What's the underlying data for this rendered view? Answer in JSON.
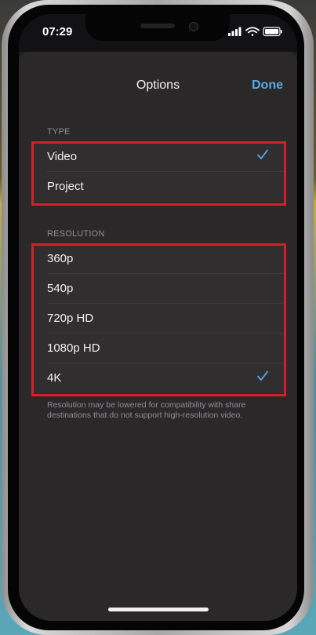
{
  "status_bar": {
    "time": "07:29"
  },
  "nav": {
    "title": "Options",
    "done_label": "Done"
  },
  "type_section": {
    "header": "TYPE",
    "items": [
      {
        "label": "Video",
        "selected": true
      },
      {
        "label": "Project",
        "selected": false
      }
    ]
  },
  "resolution_section": {
    "header": "RESOLUTION",
    "items": [
      {
        "label": "360p",
        "selected": false
      },
      {
        "label": "540p",
        "selected": false
      },
      {
        "label": "720p HD",
        "selected": false
      },
      {
        "label": "1080p HD",
        "selected": false
      },
      {
        "label": "4K",
        "selected": true
      }
    ],
    "footnote": "Resolution may be lowered for compatibility with share destinations that do not support high-resolution video."
  },
  "colors": {
    "accent": "#5aa9e6",
    "highlight": "#d81e2a",
    "sheet": "#2a2829"
  },
  "icons": {
    "check": "checkmark-icon",
    "signal": "signal-icon",
    "wifi": "wifi-icon",
    "battery": "battery-icon"
  }
}
